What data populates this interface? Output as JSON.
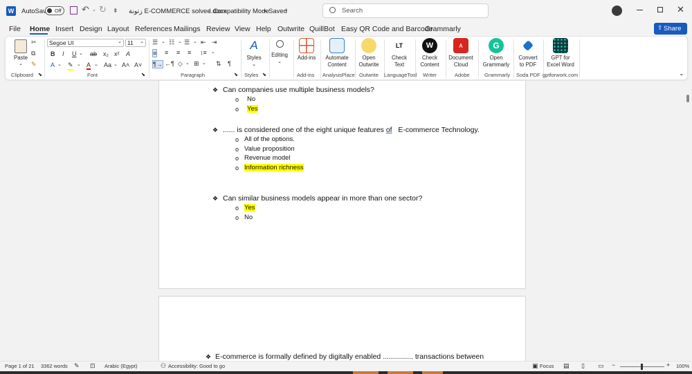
{
  "titlebar": {
    "autosave_label": "AutoSave",
    "autosave_state": "Off",
    "doc_title": "زتونة E-COMMERCE solved.docx",
    "mode": "Compatibility Mode",
    "saved": "Saved",
    "search_placeholder": "Search"
  },
  "menu": {
    "tabs": [
      "File",
      "Home",
      "Insert",
      "Design",
      "Layout",
      "References",
      "Mailings",
      "Review",
      "View",
      "Help",
      "Outwrite",
      "QuillBot",
      "Easy QR Code and Barcode",
      "Grammarly"
    ],
    "share": "Share"
  },
  "ribbon": {
    "clipboard": {
      "paste": "Paste",
      "label": "Clipboard"
    },
    "font": {
      "name": "Segoe UI",
      "size": "11",
      "label": "Font"
    },
    "paragraph": {
      "label": "Paragraph"
    },
    "styles": {
      "btn": "Styles",
      "label": "Styles"
    },
    "editing": {
      "btn": "Editing"
    },
    "addins": {
      "btn": "Add-ins",
      "label": "Add-ins"
    },
    "automate": {
      "btn": "Automate\nContent",
      "label": "AnalysisPlace"
    },
    "outwrite": {
      "btn": "Open\nOutwrite",
      "label": "Outwrite"
    },
    "checktext": {
      "btn": "Check\nText",
      "label": "LanguageTool"
    },
    "checkcontent": {
      "btn": "Check\nContent",
      "label": "Writer"
    },
    "doccloud": {
      "btn": "Document\nCloud",
      "label": "Adobe"
    },
    "grammarly": {
      "btn": "Open\nGrammarly",
      "label": "Grammarly"
    },
    "convert": {
      "btn": "Convert\nto PDF",
      "label": "Soda PDF"
    },
    "gpt": {
      "btn": "GPT for\nExcel Word",
      "label": "gptforwork.com"
    }
  },
  "document": {
    "page1": {
      "q1": {
        "text": "Can companies use multiple business models?",
        "options": [
          "No",
          "Yes"
        ]
      },
      "q2": {
        "text_a": "...... is considered one of the eight unique features ",
        "text_of": "of",
        "text_b": "   E-commerce Technology.",
        "options": [
          "All of the options.",
          "Value proposition",
          "Revenue model",
          "Information richness"
        ]
      },
      "q3": {
        "text": "Can similar business models appear in more than one sector?",
        "options": [
          "Yes",
          "No"
        ]
      }
    },
    "page2": {
      "q4": {
        "text": "E-commerce is formally defined by digitally enabled ............... transactions between"
      }
    }
  },
  "statusbar": {
    "page": "Page 1 of 21",
    "words": "3362 words",
    "language": "Arabic (Egypt)",
    "accessibility": "Accessibility: Good to go",
    "focus": "Focus",
    "zoom": "100%"
  },
  "colors": {
    "accent": "#185abd",
    "highlight": "#ffff00"
  }
}
